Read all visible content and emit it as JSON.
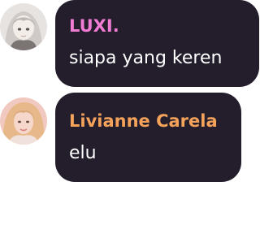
{
  "messages": [
    {
      "author": "LUXI.",
      "author_color": "#f07cd4",
      "text": "siapa yang keren",
      "avatar_icon": "anime-girl-avatar"
    },
    {
      "author": "Livianne Carela",
      "author_color": "#f5a25b",
      "text": "elu",
      "avatar_icon": "photo-portrait-avatar"
    }
  ],
  "colors": {
    "bubble_bg": "#231d2c",
    "message_text": "#ffffff",
    "page_bg": "#ffffff"
  }
}
